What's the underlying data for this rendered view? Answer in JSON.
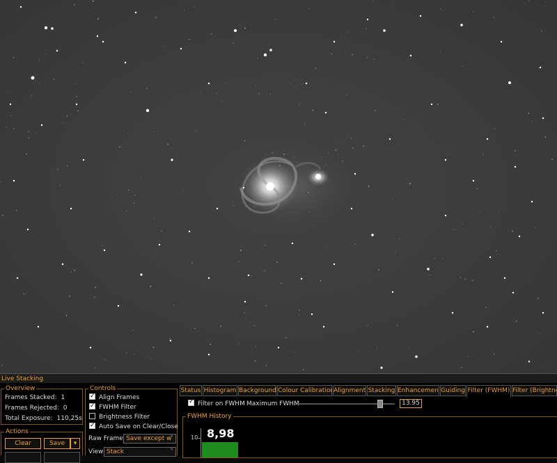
{
  "panel": {
    "title": "Live Stacking"
  },
  "overview": {
    "title": "Overview",
    "frames_stacked_label": "Frames Stacked:",
    "frames_stacked": "1",
    "frames_rejected_label": "Frames Rejected:",
    "frames_rejected": "0",
    "total_exposure_label": "Total Exposure:",
    "total_exposure": "110,25s"
  },
  "actions": {
    "title": "Actions",
    "clear_label": "Clear",
    "save_label": "Save",
    "save_dropdown_icon": "caret-down-icon"
  },
  "controls": {
    "title": "Controls",
    "items": [
      {
        "label": "Align Frames",
        "checked": true
      },
      {
        "label": "FWHM Filter",
        "checked": true
      },
      {
        "label": "Brightness Filter",
        "checked": false
      },
      {
        "label": "Auto Save on Clear/Close",
        "checked": true
      }
    ],
    "raw_frames_label": "Raw Frames",
    "raw_frames_value": "Save except w",
    "view_label": "View",
    "view_value": "Stack"
  },
  "tabs": [
    {
      "label": "Status",
      "active": false
    },
    {
      "label": "Histogram",
      "active": false
    },
    {
      "label": "Background",
      "active": false
    },
    {
      "label": "Colour Calibration",
      "active": false
    },
    {
      "label": "Alignment",
      "active": false
    },
    {
      "label": "Stacking",
      "active": false
    },
    {
      "label": "Enhancement",
      "active": false
    },
    {
      "label": "Guiding",
      "active": false
    },
    {
      "label": "Filter (FWHM)",
      "active": true
    },
    {
      "label": "Filter (Brightnes",
      "active": false
    }
  ],
  "fwhm_filter": {
    "filter_label": "Filter on FWHM",
    "filter_checked": true,
    "max_label": "Maximum FWHM",
    "max_value": "13.95",
    "slider_fraction": 0.85
  },
  "fwhm_history": {
    "title": "FWHM History",
    "current_value": "8,98",
    "axis_tick": "10",
    "bar_color": "#1e8c1e"
  },
  "colors": {
    "accent": "#f0a030",
    "background": "#000000",
    "sky": "#3a3a3a"
  }
}
